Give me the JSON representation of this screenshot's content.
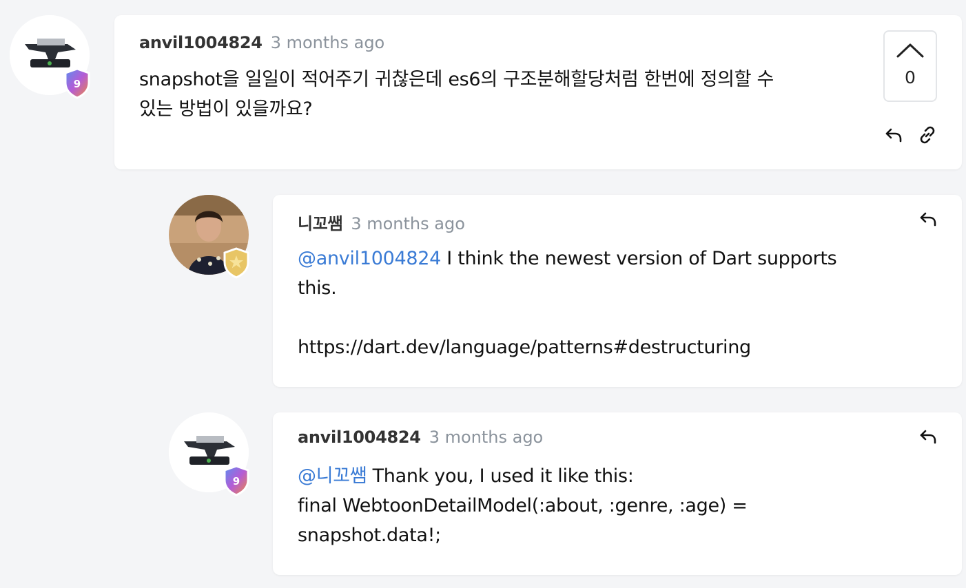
{
  "comments": [
    {
      "author": "anvil1004824",
      "time": "3 months ago",
      "text_line1": "snapshot을 일일이 적어주기 귀찮은데 es6의 구조분해할당처럼 한번에 정의할 수",
      "text_line2": "있는 방법이 있을까요?",
      "votes": "0",
      "badge_level": "9"
    },
    {
      "author": "니꼬쌤",
      "time": "3 months ago",
      "mention": "@anvil1004824",
      "text_line1": " I think the newest version of Dart supports",
      "text_line2": "this.",
      "text_line3": "https://dart.dev/language/patterns#destructuring"
    },
    {
      "author": "anvil1004824",
      "time": "3 months ago",
      "mention": "@니꼬쌤",
      "text_line1": " Thank you, I used it like this:",
      "text_line2": "final WebtoonDetailModel(:about, :genre, :age) =",
      "text_line3": "snapshot.data!;",
      "badge_level": "9"
    }
  ],
  "colors": {
    "mention": "#3a7bd5",
    "meta_time": "#8b939c",
    "background": "#f4f5f7"
  },
  "icons": [
    "anvil-avatar",
    "level-shield-badge",
    "gold-star-badge",
    "upvote-chevron-icon",
    "reply-icon",
    "link-icon"
  ]
}
